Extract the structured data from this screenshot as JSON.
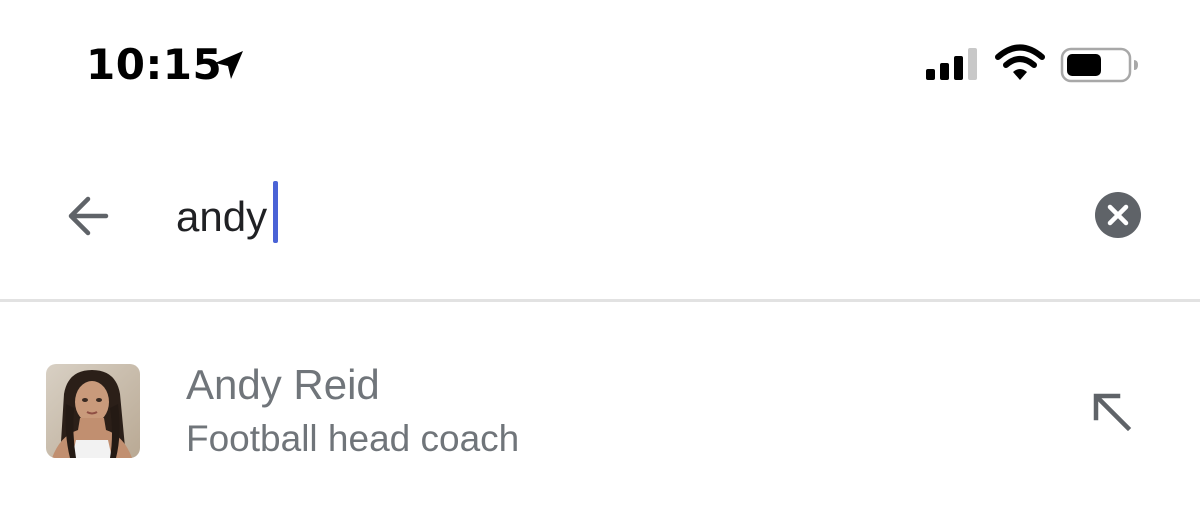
{
  "status_bar": {
    "time": "10:15",
    "icons": [
      "location-arrow-icon",
      "cellular-signal-icon",
      "wifi-icon",
      "battery-icon"
    ]
  },
  "search": {
    "value": "andy",
    "back_icon": "arrow-left-icon",
    "clear_icon": "clear-circle-x-icon",
    "cursor_color": "#4a63d6"
  },
  "suggestions": [
    {
      "title": "Andy Reid",
      "subtitle": "Football head coach",
      "thumbnail_icon": "person-photo-thumbnail",
      "action_icon": "arrow-up-left-icon"
    }
  ],
  "colors": {
    "background": "#ffffff",
    "text_primary": "#202124",
    "text_secondary": "#70757a",
    "divider": "#e2e2e2",
    "icon_grey": "#5f6368"
  }
}
